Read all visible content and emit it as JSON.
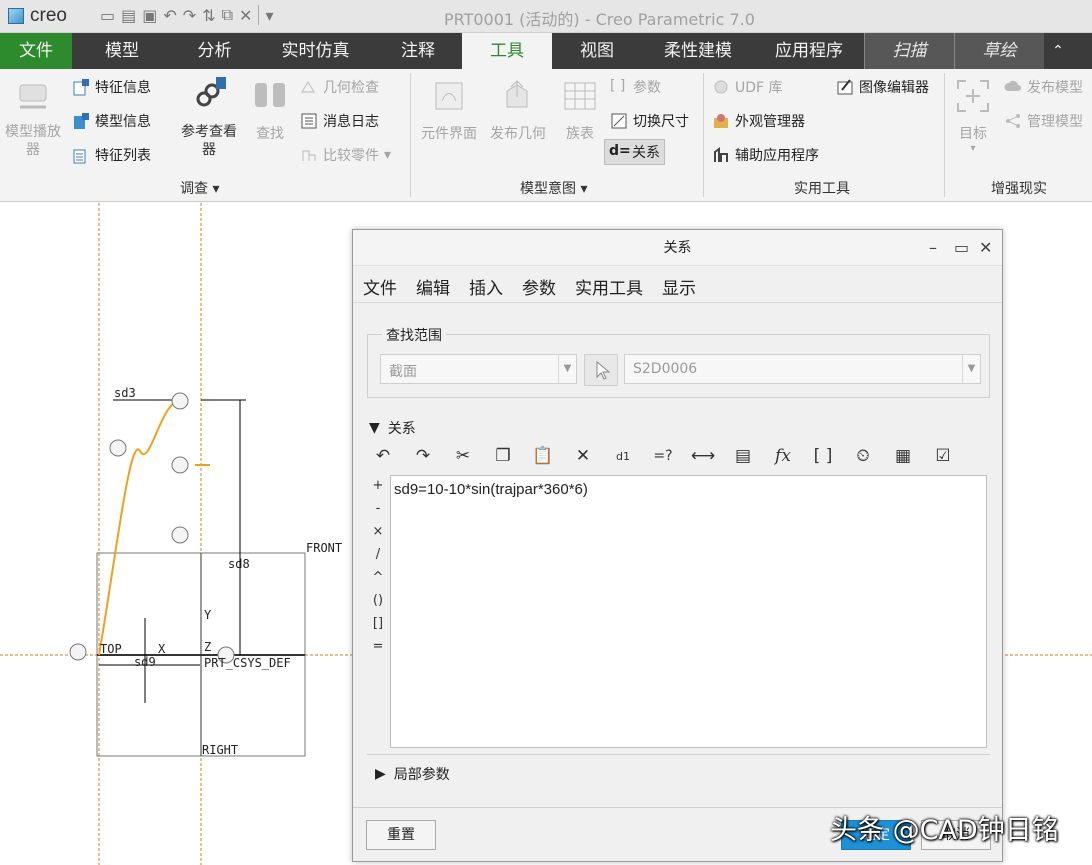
{
  "quick_access": {
    "logo": "creo",
    "window_title": "PRT0001 (活动的) - Creo Parametric 7.0"
  },
  "tabs": [
    "文件",
    "模型",
    "分析",
    "实时仿真",
    "注释",
    "工具",
    "视图",
    "柔性建模",
    "应用程序",
    "扫描",
    "草绘"
  ],
  "ribbon": {
    "investigate": {
      "model_player": "模型播放器",
      "feature_info": "特征信息",
      "model_info": "模型信息",
      "feature_list": "特征列表",
      "reference_viewer": "参考查看器",
      "find": "查找",
      "geometry_check": "几何检查",
      "message_log": "消息日志",
      "compare_part": "比较零件",
      "group": "调查"
    },
    "model_intent": {
      "component_interface": "元件界面",
      "publish_geometry": "发布几何",
      "family_table": "族表",
      "parameters": "参数",
      "switch_dimensions": "切换尺寸",
      "relations": "关系",
      "group": "模型意图"
    },
    "utilities": {
      "udf_library": "UDF 库",
      "image_editor": "图像编辑器",
      "appearance_manager": "外观管理器",
      "auxiliary_apps": "辅助应用程序",
      "group": "实用工具"
    },
    "ar": {
      "target": "目标",
      "publish_model": "发布模型",
      "manage_model": "管理模型",
      "group": "增强现实"
    }
  },
  "sketch": {
    "labels": {
      "sd3": "sd3",
      "sd8": "sd8",
      "sd9": "sd9",
      "front": "FRONT",
      "top": "TOP",
      "right": "RIGHT",
      "csys": "PRT_CSYS_DEF",
      "x": "X",
      "y": "Y",
      "z": "Z"
    }
  },
  "dialog": {
    "title": "关系",
    "menu": [
      "文件",
      "编辑",
      "插入",
      "参数",
      "实用工具",
      "显示"
    ],
    "scope_legend": "查找范围",
    "scope_type": "截面",
    "scope_item": "S2D0006",
    "relations_header": "关系",
    "operators": [
      "+",
      "-",
      "×",
      "/",
      "^",
      "()",
      "[]",
      "="
    ],
    "relation_text": "sd9=10-10*sin(trajpar*360*6)",
    "local_params": "局部参数",
    "reset": "重置",
    "ok": "确定",
    "cancel": "取消"
  },
  "watermark": "头条 @CAD钟日铭",
  "colors": {
    "file_tab": "#2d8a2d",
    "tab_bar": "#3b3b3b",
    "trajectory": "#f0a020",
    "datum": "#d08020",
    "ok_button": "#1f8fd6"
  }
}
